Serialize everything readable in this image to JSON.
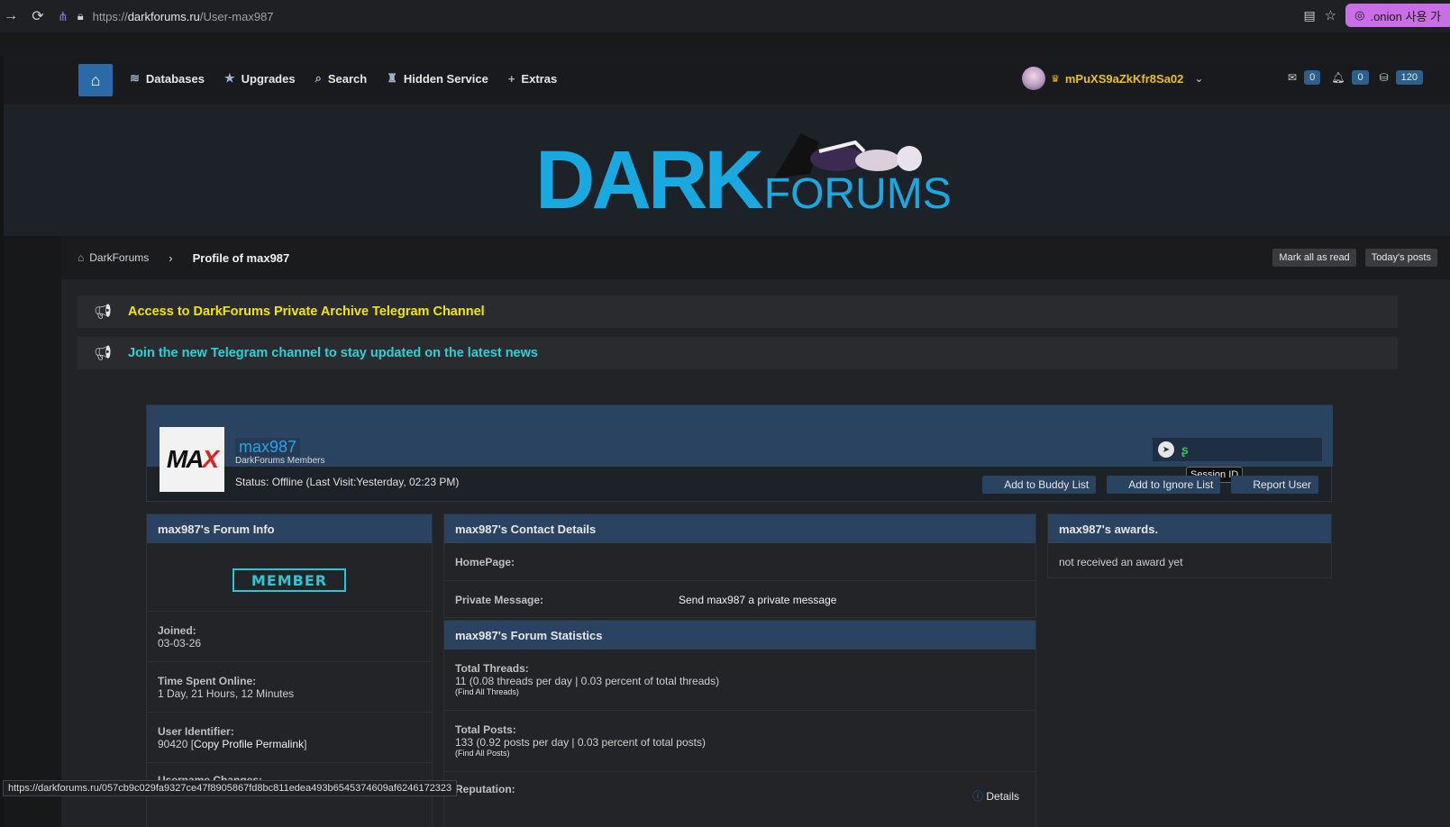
{
  "browser": {
    "url_prefix": "https://",
    "url_domain": "darkforums.ru",
    "url_path": "/User-max987",
    "onion_label": ".onion 사용 가",
    "status_url": "https://darkforums.ru/057cb9c029fa9327ce47f8905867fd8bc811edea493b6545374609af6246172323"
  },
  "nav": {
    "items": [
      {
        "label": "Databases"
      },
      {
        "label": "Upgrades"
      },
      {
        "label": "Search"
      },
      {
        "label": "Hidden Service"
      },
      {
        "label": "Extras"
      }
    ],
    "username": "mPuXS9aZkKfr8Sa02",
    "mail_count": "0",
    "notif_count": "0",
    "credits": "120"
  },
  "logo": {
    "dark": "DARK",
    "forums": "FORUMS"
  },
  "breadcrumb": {
    "home": "DarkForums",
    "current": "Profile of max987",
    "mark_read": "Mark all as read",
    "today_posts": "Today's posts"
  },
  "announcements": [
    {
      "text": "Access to DarkForums Private Archive Telegram Channel",
      "color": "#f2e600"
    },
    {
      "text": "Join the new Telegram channel to stay updated on the latest news",
      "color": "#2ad1d9"
    }
  ],
  "profile": {
    "name": "max987",
    "group": "DarkForums Members",
    "status": "Status: Offline (Last Visit:Yesterday, 02:23 PM)",
    "tooltip": "Session ID",
    "buttons": {
      "buddy": "Add to Buddy List",
      "ignore": "Add to Ignore List",
      "report": "Report User"
    }
  },
  "forum_info": {
    "title": "max987's Forum Info",
    "badge": "MEMBER",
    "joined_label": "Joined:",
    "joined": "03-03-26",
    "online_label": "Time Spent Online:",
    "online": "1 Day, 21 Hours, 12 Minutes",
    "uid_label": "User Identifier:",
    "uid": "90420",
    "permalink": "Copy Profile Permalink",
    "username_changes_label": "Username Changes:"
  },
  "contact": {
    "title": "max987's Contact Details",
    "homepage_label": "HomePage:",
    "pm_label": "Private Message:",
    "pm_value": "Send max987 a private message"
  },
  "stats": {
    "title": "max987's Forum Statistics",
    "threads_label": "Total Threads:",
    "threads": "11 (0.08 threads per day | 0.03 percent of total threads)",
    "find_threads": "(Find All Threads)",
    "posts_label": "Total Posts:",
    "posts": "133 (0.92 posts per day | 0.03 percent of total posts)",
    "find_posts": "(Find All Posts)",
    "reputation_label": "Reputation:",
    "details": "Details"
  },
  "awards": {
    "title": "max987's awards.",
    "none": "not received an award yet"
  }
}
